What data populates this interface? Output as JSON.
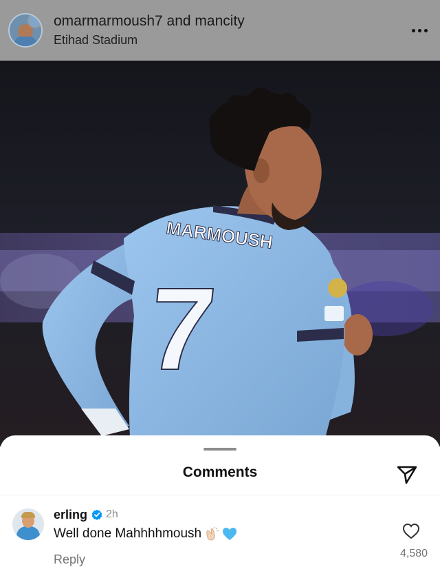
{
  "post": {
    "title": "omarmarmoush7 and mancity",
    "location": "Etihad Stadium",
    "more_icon": "more-horizontal-icon",
    "photo": {
      "jersey_name": "MARMOUSH",
      "jersey_number": "7"
    }
  },
  "comments": {
    "title": "Comments",
    "share_icon": "send-icon",
    "items": [
      {
        "username": "erling",
        "verified": true,
        "time": "2h",
        "text": "Well done Mahhhhmoush",
        "emoji": [
          "clapping-hands",
          "light-blue-heart"
        ],
        "reply_label": "Reply",
        "likes": "4,580"
      }
    ]
  },
  "colors": {
    "header_dim": "#9a9a9a",
    "sky_blue_kit": "#90bde8",
    "verified_blue": "#0095f6",
    "muted_text": "#737373"
  }
}
